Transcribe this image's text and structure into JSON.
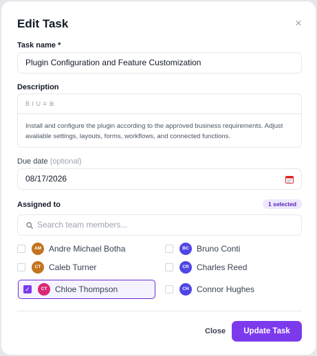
{
  "modal": {
    "title": "Edit Task",
    "close_icon": "close-icon"
  },
  "task_name": {
    "label": "Task name *",
    "value": "Plugin Configuration and Feature Customization"
  },
  "description": {
    "label": "Description",
    "toolbar": "B I U ≡ ≣",
    "text": "Install and configure the plugin according to the approved business requirements. Adjust available settings, layouts, forms, workflows, and connected functions."
  },
  "due_date": {
    "label": "Due date",
    "optional": "(optional)",
    "value": "08/17/2026",
    "icon": "calendar-icon"
  },
  "assigned": {
    "label": "Assigned to",
    "badge": "1 selected",
    "search_placeholder": "Search team members...",
    "members": [
      {
        "initials": "AM",
        "name": "Andre Michael Botha",
        "color": "#c2741e",
        "selected": false
      },
      {
        "initials": "BC",
        "name": "Bruno Conti",
        "color": "#4f46e5",
        "selected": false
      },
      {
        "initials": "CT",
        "name": "Caleb Turner",
        "color": "#c2741e",
        "selected": false
      },
      {
        "initials": "CR",
        "name": "Charles Reed",
        "color": "#4f46e5",
        "selected": false
      },
      {
        "initials": "CT",
        "name": "Chloe Thompson",
        "color": "#db2777",
        "selected": true
      },
      {
        "initials": "CH",
        "name": "Connor Hughes",
        "color": "#4f46e5",
        "selected": false
      }
    ]
  },
  "footer": {
    "close_label": "Close",
    "update_label": "Update Task"
  },
  "colors": {
    "accent": "#7c3aed",
    "border": "#e5e7eb"
  }
}
